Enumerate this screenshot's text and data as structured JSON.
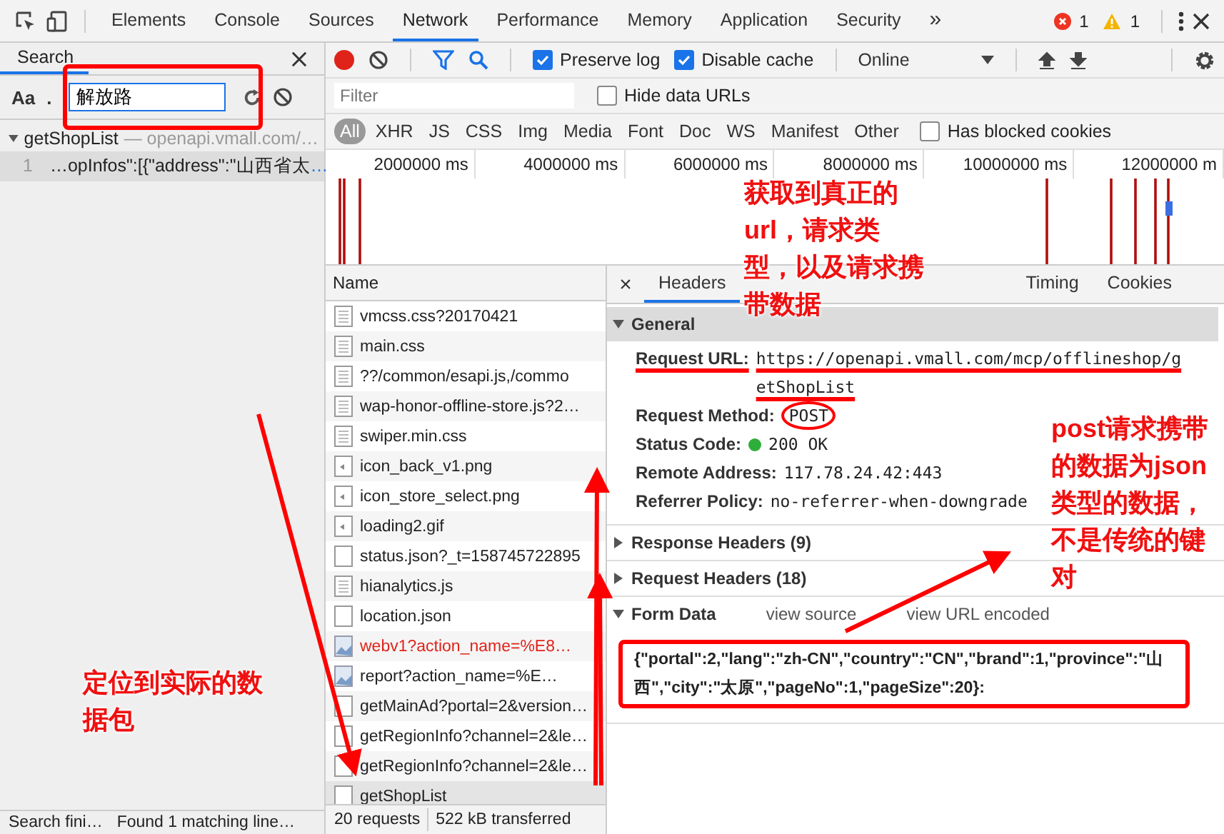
{
  "top_bar": {
    "tabs": [
      {
        "label": "Elements",
        "selected": false
      },
      {
        "label": "Console",
        "selected": false
      },
      {
        "label": "Sources",
        "selected": false
      },
      {
        "label": "Network",
        "selected": true
      },
      {
        "label": "Performance",
        "selected": false
      },
      {
        "label": "Memory",
        "selected": false
      },
      {
        "label": "Application",
        "selected": false
      },
      {
        "label": "Security",
        "selected": false
      }
    ],
    "more": "»",
    "errors": "1",
    "warnings": "1"
  },
  "search_panel": {
    "title": "Search",
    "case_toggle": "Aa",
    "regex_toggle": ".",
    "query": "解放路",
    "results": [
      {
        "file": "getShopList",
        "url": "— openapi.vmall.com/…",
        "expanded": true,
        "matches": [
          {
            "line": "1",
            "text": "…opInfos\":[{\"address\":\"山西省太",
            "more": "…"
          }
        ]
      }
    ],
    "status": "Search fini…",
    "found": "Found 1 matching line…"
  },
  "network": {
    "preserve_log": {
      "label": "Preserve log",
      "checked": true
    },
    "disable_cache": {
      "label": "Disable cache",
      "checked": true
    },
    "throttling": "Online",
    "filter": {
      "placeholder": "Filter"
    },
    "hide_data_urls": {
      "label": "Hide data URLs",
      "checked": false
    },
    "types": [
      {
        "label": "All",
        "selected": true
      },
      {
        "label": "XHR",
        "selected": false
      },
      {
        "label": "JS",
        "selected": false
      },
      {
        "label": "CSS",
        "selected": false
      },
      {
        "label": "Img",
        "selected": false
      },
      {
        "label": "Media",
        "selected": false
      },
      {
        "label": "Font",
        "selected": false
      },
      {
        "label": "Doc",
        "selected": false
      },
      {
        "label": "WS",
        "selected": false
      },
      {
        "label": "Manifest",
        "selected": false
      },
      {
        "label": "Other",
        "selected": false
      }
    ],
    "blocked_cookies": {
      "label": "Has blocked cookies",
      "checked": false
    },
    "timeline_ticks": [
      "2000000 ms",
      "4000000 ms",
      "6000000 ms",
      "8000000 ms",
      "10000000 ms",
      "12000000 m"
    ],
    "list_header": "Name",
    "requests": [
      {
        "name": "vmcss.css?20170421",
        "kind": "doc",
        "failed": false,
        "selected": false
      },
      {
        "name": "main.css",
        "kind": "doc",
        "failed": false,
        "selected": false
      },
      {
        "name": "??/common/esapi.js,/commo",
        "kind": "doc",
        "failed": false,
        "selected": false
      },
      {
        "name": "wap-honor-offline-store.js?2…",
        "kind": "doc",
        "failed": false,
        "selected": false
      },
      {
        "name": "swiper.min.css",
        "kind": "doc",
        "failed": false,
        "selected": false
      },
      {
        "name": "icon_back_v1.png",
        "kind": "image",
        "failed": false,
        "selected": false
      },
      {
        "name": "icon_store_select.png",
        "kind": "image",
        "failed": false,
        "selected": false
      },
      {
        "name": "loading2.gif",
        "kind": "image",
        "failed": false,
        "selected": false
      },
      {
        "name": "status.json?_t=158745722895",
        "kind": "blank",
        "failed": false,
        "selected": false
      },
      {
        "name": "hianalytics.js",
        "kind": "doc",
        "failed": false,
        "selected": false
      },
      {
        "name": "location.json",
        "kind": "blank",
        "failed": false,
        "selected": false
      },
      {
        "name": "webv1?action_name=%E8…",
        "kind": "ping",
        "failed": true,
        "selected": false
      },
      {
        "name": "report?action_name=%E…",
        "kind": "ping",
        "failed": false,
        "selected": false
      },
      {
        "name": "getMainAd?portal=2&version…",
        "kind": "blank",
        "failed": false,
        "selected": false
      },
      {
        "name": "getRegionInfo?channel=2&le…",
        "kind": "blank",
        "failed": false,
        "selected": false
      },
      {
        "name": "getRegionInfo?channel=2&le…",
        "kind": "blank",
        "failed": false,
        "selected": false
      },
      {
        "name": "getShopList",
        "kind": "blank",
        "failed": false,
        "selected": true
      }
    ],
    "status": {
      "requests": "20 requests",
      "transferred": "522 kB transferred"
    }
  },
  "details": {
    "close": "×",
    "tabs": [
      {
        "label": "Headers",
        "selected": true
      },
      {
        "label": "Timing",
        "selected": false
      },
      {
        "label": "Cookies",
        "selected": false
      }
    ],
    "general": {
      "title": "General",
      "expanded": true,
      "fields": [
        {
          "label": "Request URL:",
          "value": "https://openapi.vmall.com/mcp/offlineshop/getShopList",
          "kind": "text"
        },
        {
          "label": "Request Method:",
          "value": "POST",
          "kind": "text"
        },
        {
          "label": "Status Code:",
          "value": "200 OK",
          "kind": "status"
        },
        {
          "label": "Remote Address:",
          "value": "117.78.24.42:443",
          "kind": "text"
        },
        {
          "label": "Referrer Policy:",
          "value": "no-referrer-when-downgrade",
          "kind": "text"
        }
      ]
    },
    "sections": [
      {
        "title": "Response Headers (9)",
        "expanded": false
      },
      {
        "title": "Request Headers (18)",
        "expanded": false
      }
    ],
    "form_data": {
      "title": "Form Data",
      "expanded": true,
      "links": [
        "view source",
        "view URL encoded"
      ],
      "payload": "{\"portal\":2,\"lang\":\"zh-CN\",\"country\":\"CN\",\"brand\":1,\"province\":\"山西\",\"city\":\"太原\",\"pageNo\":1,\"pageSize\":20}:"
    }
  },
  "annotations": [
    {
      "kind": "note",
      "lines": [
        "获取到真正的",
        "url，请求类",
        "型，以及请求携",
        "带数据"
      ]
    },
    {
      "kind": "note",
      "lines": [
        "post请求携带",
        "的数据为json",
        "类型的数据，",
        "不是传统的键",
        "对"
      ]
    },
    {
      "kind": "note",
      "lines": [
        "定位到实际的数",
        "据包"
      ]
    }
  ]
}
